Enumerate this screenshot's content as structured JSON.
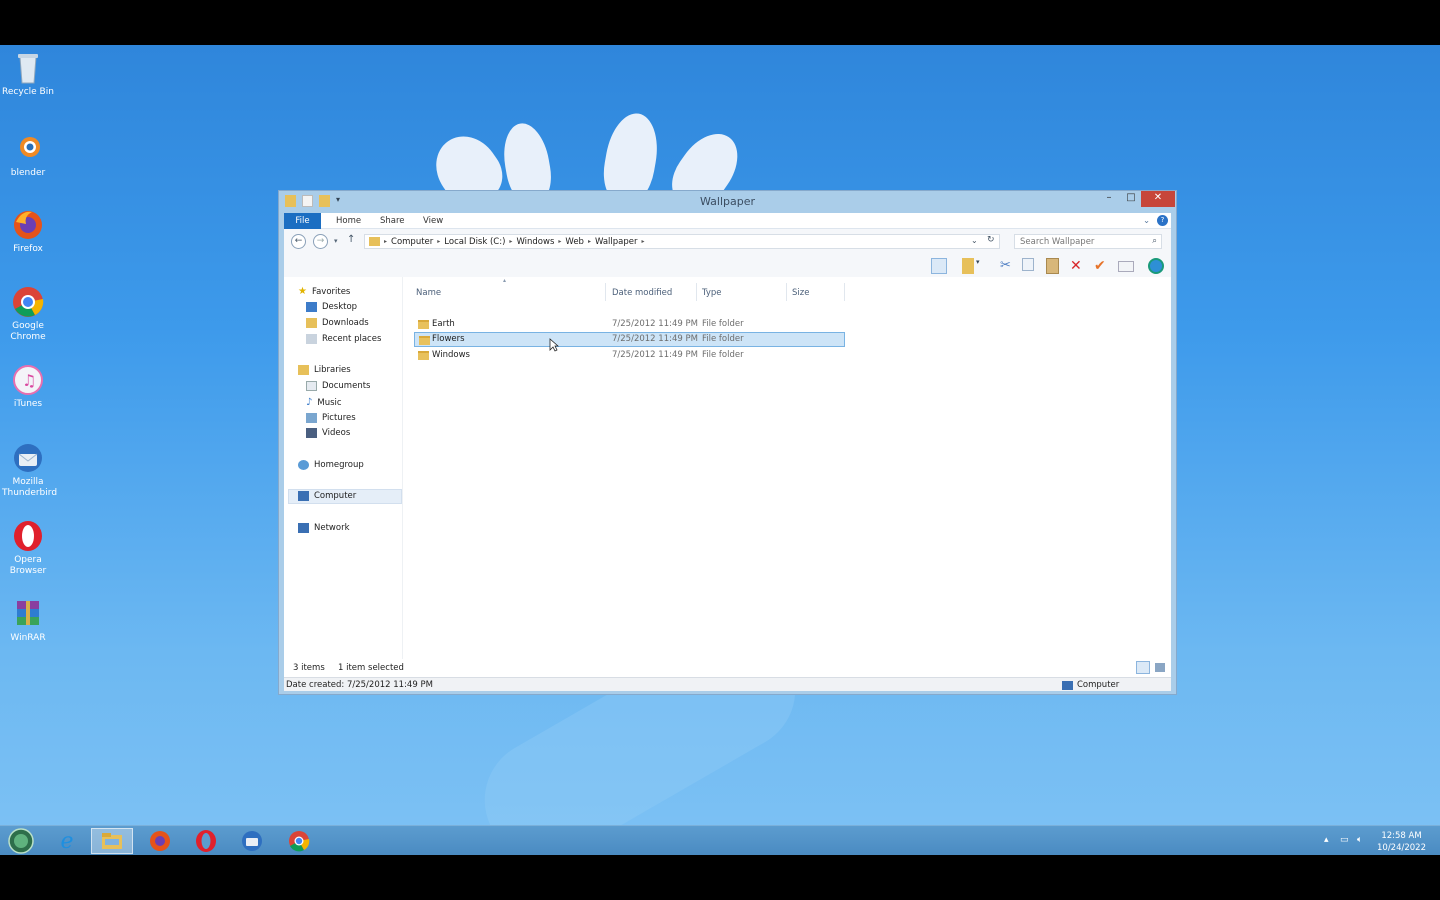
{
  "desktop": {
    "icons": [
      {
        "label": "Recycle Bin"
      },
      {
        "label": "blender"
      },
      {
        "label": "Firefox"
      },
      {
        "label": "Google Chrome"
      },
      {
        "label": "iTunes"
      },
      {
        "label": "Mozilla Thunderbird"
      },
      {
        "label": "Opera Browser"
      },
      {
        "label": "WinRAR"
      }
    ]
  },
  "window": {
    "title": "Wallpaper",
    "ribbon_tabs": [
      "File",
      "Home",
      "Share",
      "View"
    ],
    "address_crumbs": [
      "Computer",
      "Local Disk (C:)",
      "Windows",
      "Web",
      "Wallpaper"
    ],
    "search_placeholder": "Search Wallpaper",
    "nav": {
      "favorites": {
        "label": "Favorites",
        "items": [
          "Desktop",
          "Downloads",
          "Recent places"
        ]
      },
      "libraries": {
        "label": "Libraries",
        "items": [
          "Documents",
          "Music",
          "Pictures",
          "Videos"
        ]
      },
      "homegroup": "Homegroup",
      "computer": "Computer",
      "network": "Network"
    },
    "columns": [
      "Name",
      "Date modified",
      "Type",
      "Size"
    ],
    "rows": [
      {
        "name": "Earth",
        "date": "7/25/2012 11:49 PM",
        "type": "File folder",
        "size": ""
      },
      {
        "name": "Flowers",
        "date": "7/25/2012 11:49 PM",
        "type": "File folder",
        "size": ""
      },
      {
        "name": "Windows",
        "date": "7/25/2012 11:49 PM",
        "type": "File folder",
        "size": ""
      }
    ],
    "status": {
      "count": "3 items",
      "selected": "1 item selected"
    },
    "details": {
      "date_created": "Date created: 7/25/2012 11:49 PM",
      "location": "Computer"
    }
  },
  "taskbar": {
    "clock_time": "12:58 AM",
    "clock_date": "10/24/2022"
  },
  "colors": {
    "accent": "#1b6ec2",
    "selection": "#cde4f7",
    "close": "#c7463a"
  }
}
